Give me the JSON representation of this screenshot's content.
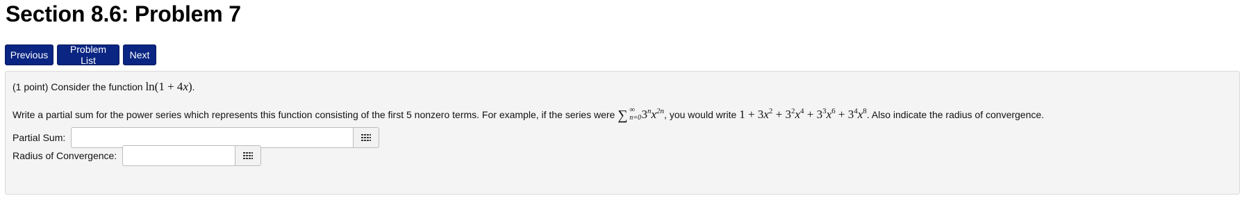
{
  "header": {
    "title": "Section 8.6: Problem 7"
  },
  "nav": {
    "previous_label": "Previous",
    "problem_list_label": "Problem List",
    "next_label": "Next"
  },
  "problem": {
    "intro_text": "(1 point) Consider the function ",
    "function_math": "ln(1 + 4x)",
    "intro_end": ".",
    "instruction_part1": "Write a partial sum for the power series which represents this function consisting of the first 5 nonzero terms. For example, if the series were ",
    "series_sigma": "∑",
    "series_upper": "∞",
    "series_lower": "n=0",
    "series_term_base": "3",
    "series_term_base_exp": "n",
    "series_term_var": "x",
    "series_term_var_exp": "2n",
    "instruction_part2": ", you would write ",
    "example_terms": [
      {
        "text": "1"
      },
      {
        "text": "+ 3x",
        "exp": "2"
      },
      {
        "text": "+ 3",
        "exp": "2",
        "text2": "x",
        "exp2": "4"
      },
      {
        "text": "+ 3",
        "exp": "3",
        "text2": "x",
        "exp2": "6"
      },
      {
        "text": "+ 3",
        "exp": "4",
        "text2": "x",
        "exp2": "8"
      }
    ],
    "instruction_part3": ". Also indicate the radius of convergence."
  },
  "answers": {
    "partial_sum_label": "Partial Sum:",
    "partial_sum_value": "",
    "radius_label": "Radius of Convergence:",
    "radius_value": ""
  },
  "icons": {
    "palette": "grid-palette-icon"
  }
}
